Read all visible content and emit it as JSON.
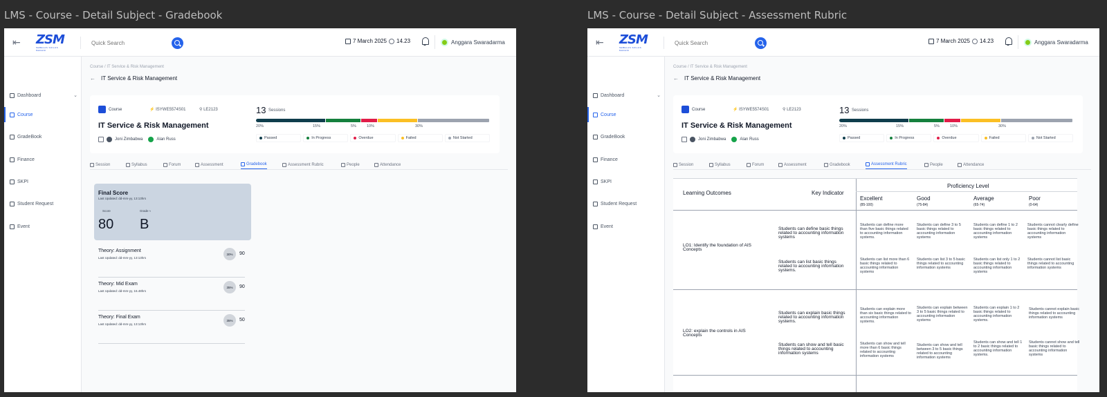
{
  "frames": [
    {
      "label": "LMS - Course - Detail Subject - Gradebook"
    },
    {
      "label": "LMS - Course - Detail Subject - Assessment Rubric"
    }
  ],
  "topbar": {
    "logo_text": "ZSM",
    "logo_sub": "SEBELAS SIKLUS MADANI",
    "search_placeholder": "Quick Search",
    "date": "7 March 2025",
    "time": "14.23",
    "user_name": "Anggara Swaradarma"
  },
  "sidebar": {
    "items": [
      {
        "label": "Dashboard",
        "icon": "dashboard-icon"
      },
      {
        "label": "Course",
        "icon": "course-icon"
      },
      {
        "label": "GradeBook",
        "icon": "gradebook-icon"
      },
      {
        "label": "Finance",
        "icon": "finance-icon"
      },
      {
        "label": "SKPI",
        "icon": "skpi-icon"
      },
      {
        "label": "Student Request",
        "icon": "request-icon"
      },
      {
        "label": "Event",
        "icon": "event-icon"
      }
    ]
  },
  "breadcrumb": "Course  /  IT Service & Risk Management",
  "page_title": "IT Service & Risk Management",
  "course": {
    "tag": "Course",
    "code": "ISYWE5574S01",
    "room": "LE2123",
    "name": "IT Service & Risk Management",
    "lecturers": [
      "Joni Zimbabwa",
      "Alan Russ"
    ],
    "sessions_count": "13",
    "sessions_label": "Sessions",
    "progress": [
      {
        "label": "20%",
        "value": 0.3,
        "color": "#0f3d4c"
      },
      {
        "label": "15%",
        "value": 0.15,
        "color": "#15803d"
      },
      {
        "label": "5%",
        "value": 0.07,
        "color": "#e11d48"
      },
      {
        "label": "10%",
        "value": 0.17,
        "color": "#fbbf24"
      },
      {
        "label": "30%",
        "value": 0.31,
        "color": "#9ca3af"
      }
    ],
    "legend": [
      {
        "label": "Passed",
        "color": "#0f3d4c"
      },
      {
        "label": "In Progress",
        "color": "#15803d"
      },
      {
        "label": "Overdue",
        "color": "#e11d48"
      },
      {
        "label": "Failed",
        "color": "#fbbf24"
      },
      {
        "label": "Not Started",
        "color": "#9ca3af"
      }
    ]
  },
  "tabs": [
    "Session",
    "Syllabus",
    "Forum",
    "Assessment",
    "Gradebook",
    "Assessment Rubric",
    "People",
    "Attendance"
  ],
  "gradebook": {
    "final_title": "Final Score",
    "final_updated": "Last Updated: dd-mm-yy, 13:13hrs",
    "score_label": "Score",
    "grade_label": "Grade ≈",
    "score": "80",
    "grade": "B",
    "items": [
      {
        "title": "Theory: Assignment",
        "updated": "Last Updated: dd-mm-yy, 13:13hrs",
        "weight": "30%",
        "score": "90"
      },
      {
        "title": "Theory: Mid Exam",
        "updated": "Last Updated: dd-mm-yy, 16.48hrs",
        "weight": "35%",
        "score": "90"
      },
      {
        "title": "Theory: Final Exam",
        "updated": "Last Updated: dd-mm-yy, 13:13hrs",
        "weight": "35%",
        "score": "50"
      }
    ]
  },
  "rubric": {
    "col_lo": "Learning Outcomes",
    "col_ki": "Key Indicator",
    "col_prof": "Proficiency Level",
    "levels": [
      {
        "name": "Excellent",
        "range": "(85-100)"
      },
      {
        "name": "Good",
        "range": "(75-84)"
      },
      {
        "name": "Average",
        "range": "(65-74)"
      },
      {
        "name": "Poor",
        "range": "(0-64)"
      }
    ],
    "rows": [
      {
        "lo": "LO1: Identify the foundation of AIS Concepts",
        "indicators": [
          {
            "text": "Students can define basic things related to accounting information systems",
            "cells": [
              "Students can define more than five basic things related to accounting information systems.",
              "Students can define 3 to 5 basic things related to accounting information systems",
              "Students can define 1 to 2 basic things related to accounting information systems",
              "Students cannot clearly define basic things related to accounting information systems"
            ]
          },
          {
            "text": "Students can list basic things related to accounting information systems.",
            "cells": [
              "Students can list more than 6 basic things related to accounting information systems",
              "Students can list 3 to 5 basic things related to accounting information systems",
              "Students can list only 1 to 2 basic things related to accounting information systems",
              "Students cannot list basic things related to accounting information systems"
            ]
          }
        ]
      },
      {
        "lo": "LO2: explain the controls in AIS Concepts",
        "indicators": [
          {
            "text": "Students can explain basic things related to accounting information systems.",
            "cells": [
              "Students can explain more than six basic things related to accounting information systems.",
              "Students can explain between 3 to 5 basic things related to accounting information systems",
              "Students can explain 1 to 2 basic things related to accounting information systems.",
              "Students cannot explain basic things related to accounting information systems"
            ]
          },
          {
            "text": "Students can show and tell basic things related to accounting information systems",
            "cells": [
              "Students can show and tell more than 6 basic things related to accounting information systems",
              "Students can show and tell between 3 to 5 basic things related to accounting information systems",
              "Students can show and tell 1 to 2 basic things related to accounting information systems.",
              "Students cannot show and tell basic things related to accounting information systems"
            ]
          }
        ]
      }
    ]
  },
  "colors": {
    "accent": "#2563eb",
    "score_card": "#cbd5e1"
  }
}
